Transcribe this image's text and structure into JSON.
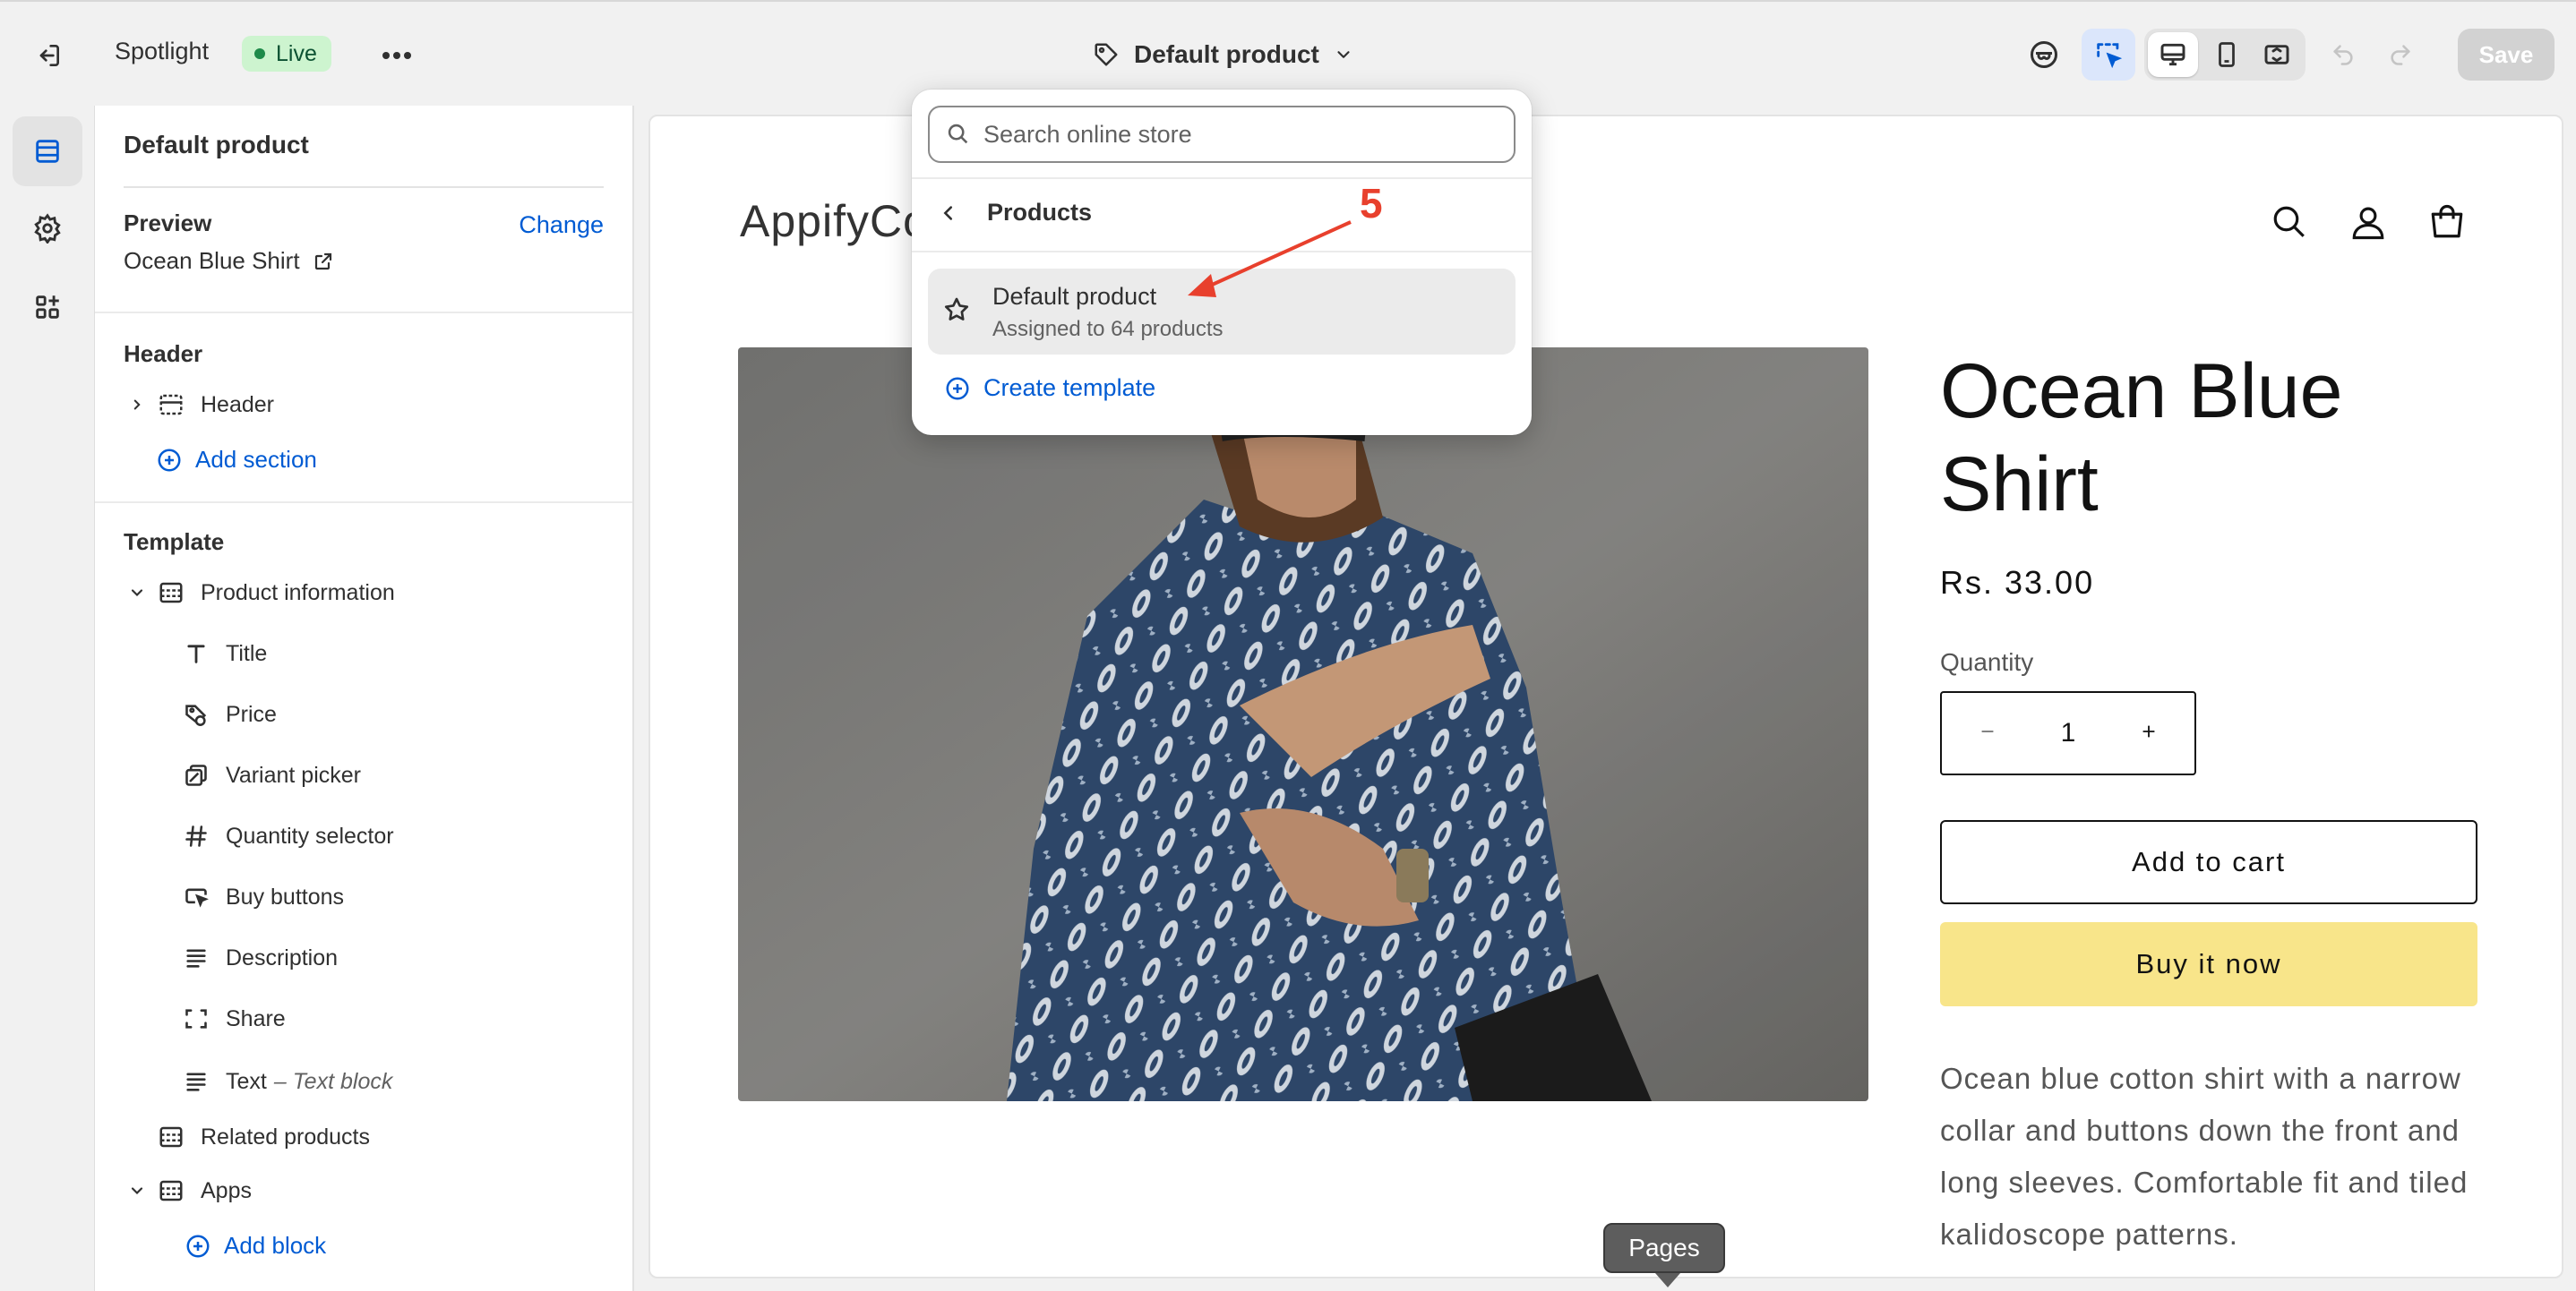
{
  "topbar": {
    "theme_name": "Spotlight",
    "live_badge": "Live",
    "template_selector": "Default product",
    "save_label": "Save"
  },
  "sidebar": {
    "title": "Default product",
    "preview_label": "Preview",
    "preview_change": "Change",
    "preview_product": "Ocean Blue Shirt",
    "header_group": "Header",
    "header_item": "Header",
    "add_section": "Add section",
    "template_group": "Template",
    "product_information": "Product information",
    "blocks": [
      {
        "label": "Title",
        "icon": "text-t-icon"
      },
      {
        "label": "Price",
        "icon": "price-tag-icon"
      },
      {
        "label": "Variant picker",
        "icon": "variant-icon"
      },
      {
        "label": "Quantity selector",
        "icon": "hash-icon"
      },
      {
        "label": "Buy buttons",
        "icon": "cursor-button-icon"
      },
      {
        "label": "Description",
        "icon": "text-lines-icon"
      },
      {
        "label": "Share",
        "icon": "share-frame-icon"
      }
    ],
    "text_block_main": "Text",
    "text_block_sub": "– Text block",
    "related_products": "Related products",
    "apps": "Apps",
    "add_block": "Add block"
  },
  "dropdown": {
    "search_placeholder": "Search online store",
    "back_label": "Products",
    "item_title": "Default product",
    "item_subtitle": "Assigned to 64 products",
    "create_template": "Create template",
    "annotation_number": "5"
  },
  "preview": {
    "store_logo": "AppifyCo",
    "product_title": "Ocean Blue Shirt",
    "price": "Rs. 33.00",
    "quantity_label": "Quantity",
    "quantity_value": "1",
    "add_to_cart": "Add to cart",
    "buy_now": "Buy it now",
    "description": "Ocean blue cotton shirt with a narrow collar and buttons down the front and long sleeves. Comfortable fit and tiled kalidoscope patterns."
  },
  "tooltip": {
    "pages": "Pages"
  },
  "colors": {
    "accent_link": "#005bd3",
    "live_badge_bg": "#cdf4cf",
    "buy_now_bg": "#f8e58a",
    "annotation_red": "#e8402d"
  }
}
